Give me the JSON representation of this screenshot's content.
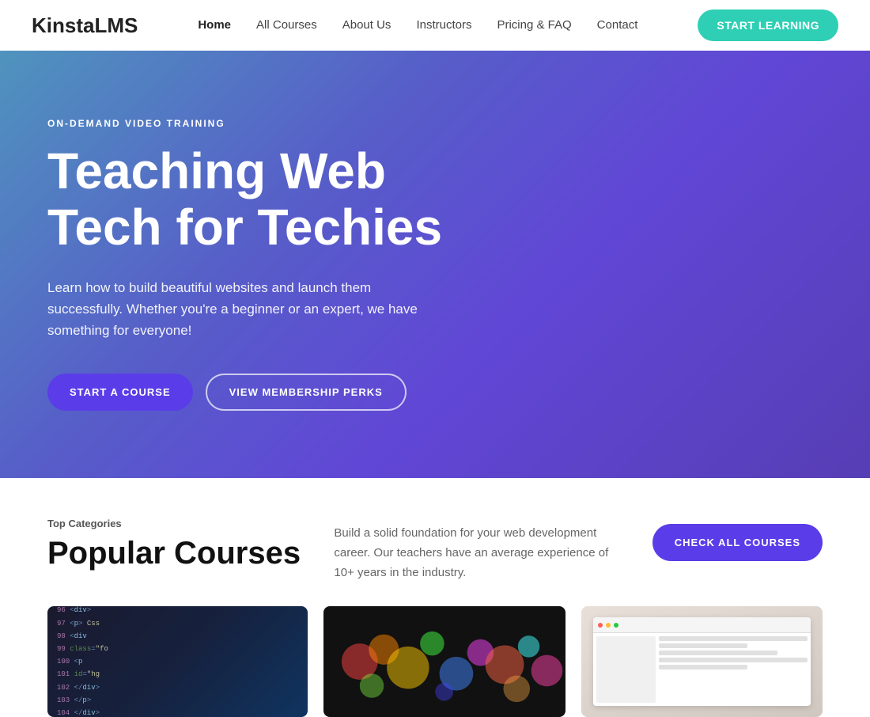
{
  "logo": {
    "part1": "Kinsta",
    "part2": "LMS"
  },
  "nav": {
    "links": [
      {
        "label": "Home",
        "active": true
      },
      {
        "label": "All Courses",
        "active": false
      },
      {
        "label": "About Us",
        "active": false
      },
      {
        "label": "Instructors",
        "active": false
      },
      {
        "label": "Pricing & FAQ",
        "active": false
      },
      {
        "label": "Contact",
        "active": false
      }
    ],
    "cta_label": "START LEARNING"
  },
  "hero": {
    "eyebrow": "ON-DEMAND VIDEO TRAINING",
    "title_line1": "Teaching Web",
    "title_line2": "Tech for Techies",
    "subtitle": "Learn how to build beautiful websites and launch them successfully. Whether you're a beginner or an expert, we have something for everyone!",
    "btn_start": "START A COURSE",
    "btn_membership": "VIEW MEMBERSHIP PERKS"
  },
  "popular_section": {
    "top_label": "Top Categories",
    "title": "Popular Courses",
    "description": "Build a solid foundation for your web development career. Our teachers have an average experience of 10+ years in the industry.",
    "btn_check": "CHECK ALL COURSES"
  },
  "colors": {
    "purple": "#5a3de8",
    "teal": "#2ecfb5",
    "hero_grad_start": "#4fc3c3",
    "hero_grad_end": "#6a4de8"
  }
}
